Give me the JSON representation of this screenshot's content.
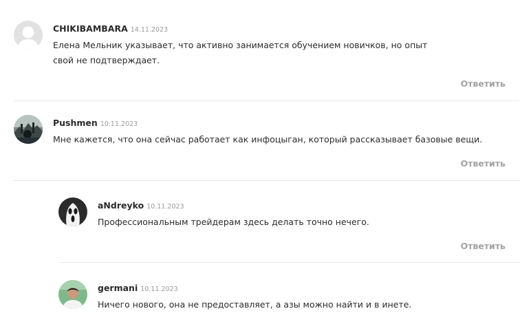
{
  "comments": [
    {
      "author": "CHIKIBAMBARA",
      "date": "14.11.2023",
      "text": "Елена Мельник указывает, что активно занимается обучением новичков, но опыт свой не подтверждает.",
      "reply_label": "Ответить",
      "avatar_icon": "default-user-avatar"
    },
    {
      "author": "Pushmen",
      "date": "10.11.2023",
      "text": "Мне кажется, что она сейчас работает как инфоцыган, который рассказывает базовые вещи.",
      "reply_label": "Ответить",
      "avatar_icon": "photo-avatar"
    },
    {
      "author": "aNdreyko",
      "date": "10.11.2023",
      "text": "Профессиональным трейдерам здесь делать точно нечего.",
      "reply_label": "Ответить",
      "avatar_icon": "scream-mask-avatar"
    },
    {
      "author": "germani",
      "date": "10.11.2023",
      "text": "Ничего нового, она не предоставляет, а азы можно найти и в инете.",
      "avatar_icon": "photo-avatar"
    }
  ],
  "colors": {
    "author": "#2a2a2a",
    "date": "#9a9a9a",
    "reply": "#a3a3a3",
    "divider": "#e9e9e9"
  }
}
